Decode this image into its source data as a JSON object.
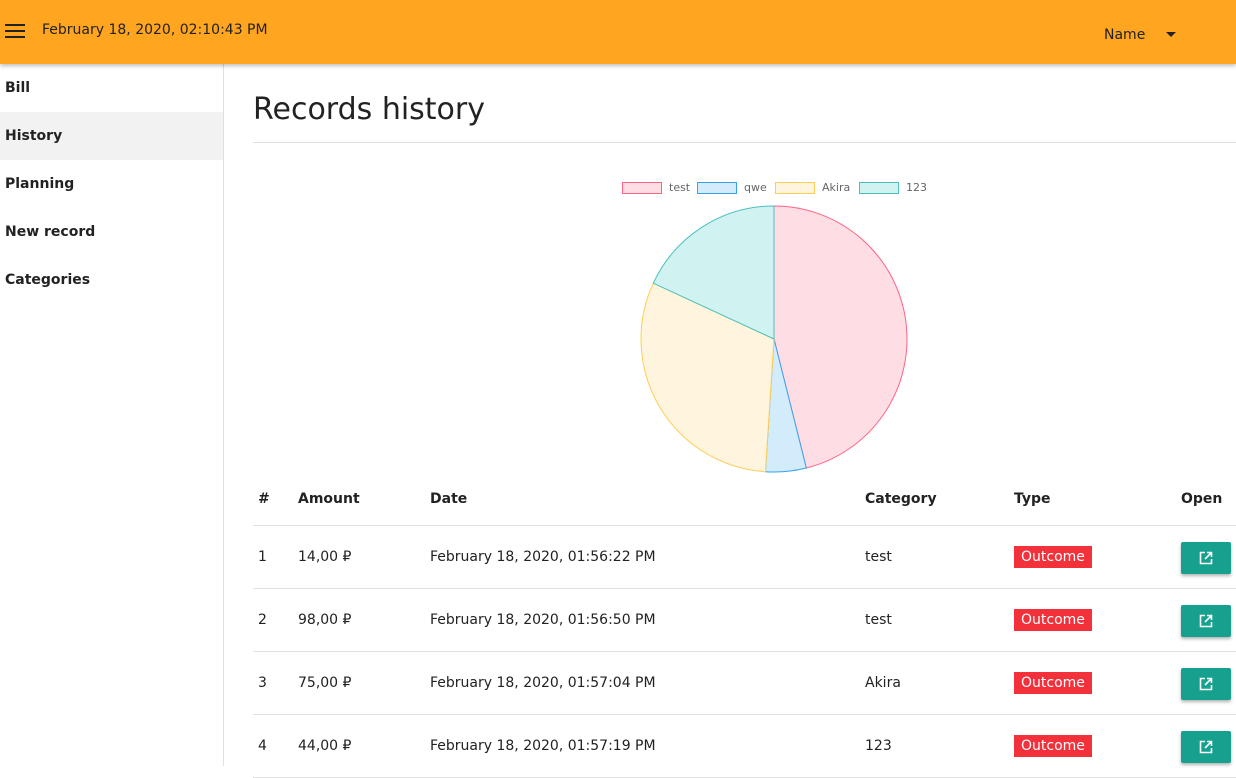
{
  "header": {
    "menu_icon": "hamburger-menu-icon",
    "datetime": "February 18, 2020, 02:10:43 PM",
    "user_name": "Name",
    "dropdown_icon": "caret-down-icon"
  },
  "sidebar": {
    "items": [
      {
        "label": "Bill",
        "active": false
      },
      {
        "label": "History",
        "active": true
      },
      {
        "label": "Planning",
        "active": false
      },
      {
        "label": "New record",
        "active": false
      },
      {
        "label": "Categories",
        "active": false
      }
    ]
  },
  "main": {
    "title": "Records history"
  },
  "chart_data": {
    "type": "pie",
    "labels": [
      "test",
      "qwe",
      "Akira",
      "123"
    ],
    "values": [
      112,
      12,
      75,
      44
    ],
    "colors": {
      "fill": [
        "#ffdde4",
        "#d3ecfb",
        "#fff4dd",
        "#d0f2f0"
      ],
      "border": [
        "#ff6384",
        "#36a2eb",
        "#ffcd56",
        "#4bc0c0"
      ]
    },
    "legend_position": "top",
    "title": ""
  },
  "table": {
    "headers": [
      "#",
      "Amount",
      "Date",
      "Category",
      "Type",
      "Open"
    ],
    "rows": [
      {
        "num": "1",
        "amount": "14,00 ₽",
        "date": "February 18, 2020, 01:56:22 PM",
        "category": "test",
        "type": "Outcome"
      },
      {
        "num": "2",
        "amount": "98,00 ₽",
        "date": "February 18, 2020, 01:56:50 PM",
        "category": "test",
        "type": "Outcome"
      },
      {
        "num": "3",
        "amount": "75,00 ₽",
        "date": "February 18, 2020, 01:57:04 PM",
        "category": "Akira",
        "type": "Outcome"
      },
      {
        "num": "4",
        "amount": "44,00 ₽",
        "date": "February 18, 2020, 01:57:19 PM",
        "category": "123",
        "type": "Outcome"
      }
    ],
    "open_icon": "open-in-new-icon"
  },
  "colors": {
    "header_bg": "#ffa51f",
    "outcome_badge": "#f2313b",
    "open_button": "#16a08e",
    "active_nav_bg": "#f2f2f2"
  }
}
